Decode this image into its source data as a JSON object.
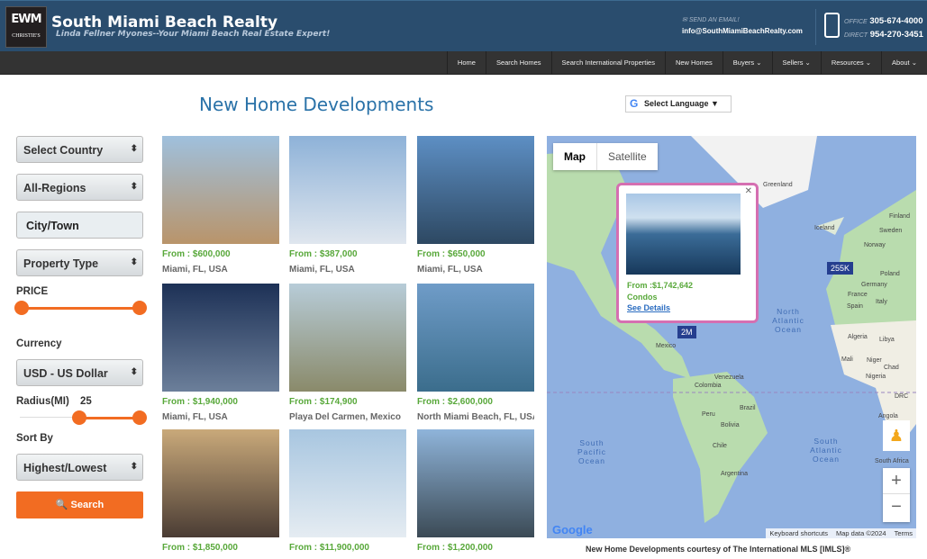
{
  "header": {
    "logo_text": "EWM",
    "logo_sub": "CHRISTIE'S",
    "title": "South Miami Beach Realty",
    "tagline": "Linda Fellner Myones--Your Miami Beach Real Estate Expert!",
    "email_label": "SEND AN EMAIL!",
    "email": "info@SouthMiamiBeachRealty.com",
    "office_label": "OFFICE",
    "office": "305-674-4000",
    "direct_label": "DIRECT",
    "direct": "954-270-3451"
  },
  "nav": [
    "Home",
    "Search Homes",
    "Search International Properties",
    "New Homes",
    "Buyers ⌄",
    "Sellers ⌄",
    "Resources ⌄",
    "About ⌄"
  ],
  "page_title": "New Home Developments",
  "language": "Select Language ▼",
  "filters": {
    "country": "Select Country",
    "region": "All-Regions",
    "city_placeholder": "City/Town",
    "property_type": "Property Type",
    "price_label": "PRICE",
    "price_range": [
      0,
      100
    ],
    "currency_label": "Currency",
    "currency": "USD - US Dollar",
    "radius_label": "Radius(MI)",
    "radius": "25",
    "sort_label": "Sort By",
    "sort": "Highest/Lowest",
    "search": "🔍 Search"
  },
  "listings": [
    {
      "price": "From : $600,000",
      "location": "Miami, FL, USA",
      "img": [
        "#9fc0dd",
        "#b9946a"
      ]
    },
    {
      "price": "From : $387,000",
      "location": "Miami, FL, USA",
      "img": [
        "#8eb2d8",
        "#dfe6ee"
      ]
    },
    {
      "price": "From : $650,000",
      "location": "Miami, FL, USA",
      "img": [
        "#5d8fc4",
        "#2d4862"
      ]
    },
    {
      "price": "From : $1,940,000",
      "location": "Miami, FL, USA",
      "img": [
        "#1d3156",
        "#6c7f9a"
      ]
    },
    {
      "price": "From : $174,900",
      "location": "Playa Del Carmen, Mexico",
      "img": [
        "#b7ccd8",
        "#8a8a6a"
      ]
    },
    {
      "price": "From : $2,600,000",
      "location": "North Miami Beach, FL, USA",
      "img": [
        "#6f9cc8",
        "#3b6d8c"
      ]
    },
    {
      "price": "From : $1,850,000",
      "location": "",
      "img": [
        "#c9a97a",
        "#4a3c34"
      ]
    },
    {
      "price": "From : $11,900,000",
      "location": "",
      "img": [
        "#a8c6e0",
        "#e5ecf2"
      ]
    },
    {
      "price": "From : $1,200,000",
      "location": "",
      "img": [
        "#8fb4da",
        "#3b4a55"
      ]
    }
  ],
  "map": {
    "tab_map": "Map",
    "tab_satellite": "Satellite",
    "popup": {
      "price": "From :$1,742,642",
      "type": "Condos",
      "link": "See Details"
    },
    "markers": [
      "255K",
      "2M"
    ],
    "labels": [
      "Greenland",
      "Iceland",
      "Finland",
      "Sweden",
      "Norway",
      "Poland",
      "Germany",
      "France",
      "Spain",
      "Italy",
      "Algeria",
      "Libya",
      "Mali",
      "Niger",
      "Chad",
      "Nigeria",
      "DRC",
      "Angola",
      "South Africa",
      "Mexico",
      "Venezuela",
      "Colombia",
      "Brazil",
      "Peru",
      "Bolivia",
      "Chile",
      "Argentina"
    ],
    "oceans": [
      "North Atlantic Ocean",
      "South Pacific Ocean",
      "South Atlantic Ocean"
    ],
    "zoom_in": "+",
    "zoom_out": "−",
    "google": "Google",
    "attribution": [
      "Keyboard shortcuts",
      "Map data ©2024",
      "Terms"
    ]
  },
  "caption": "New Home Developments courtesy of The International MLS [IMLS]®"
}
